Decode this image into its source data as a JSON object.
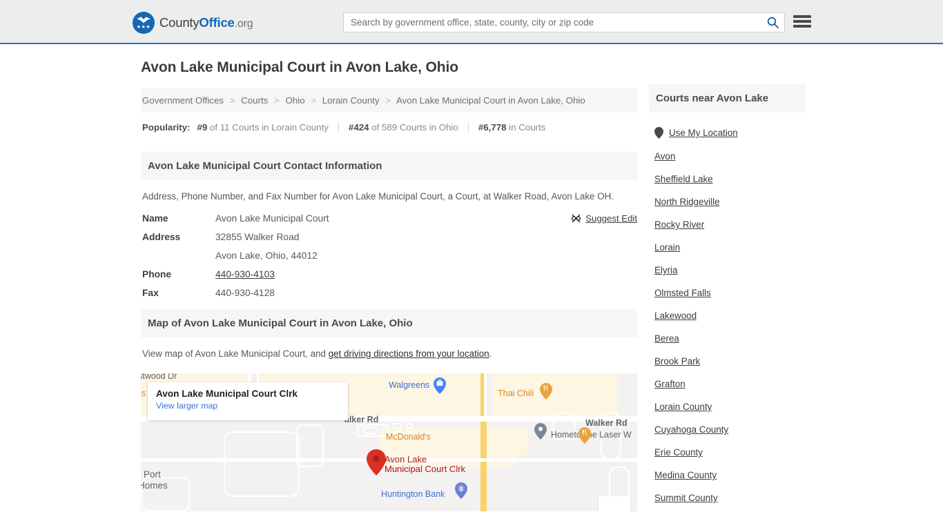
{
  "header": {
    "logo_text_county": "County",
    "logo_text_office": "Office",
    "logo_text_org": ".org",
    "logo_icon": "eagle-stars-emblem",
    "search_placeholder": "Search by government office, state, county, city or zip code",
    "search_value": "",
    "search_icon": "search-icon",
    "menu_icon": "hamburger-menu-icon"
  },
  "main": {
    "title": "Avon Lake Municipal Court in Avon Lake, Ohio",
    "breadcrumb": [
      "Government Offices",
      "Courts",
      "Ohio",
      "Lorain County",
      "Avon Lake Municipal Court in Avon Lake, Ohio"
    ],
    "breadcrumb_separator": ">",
    "popularity": {
      "label": "Popularity:",
      "stats": [
        {
          "rank": "#9",
          "rest": " of 11 Courts in Lorain County"
        },
        {
          "rank": "#424",
          "rest": " of 589 Courts in Ohio"
        },
        {
          "rank": "#6,778",
          "rest": " in Courts"
        }
      ]
    },
    "contact_section": {
      "heading": "Avon Lake Municipal Court Contact Information",
      "description": "Address, Phone Number, and Fax Number for Avon Lake Municipal Court, a Court, at Walker Road, Avon Lake OH.",
      "suggest_edit_label": "Suggest Edit",
      "suggest_edit_icon": "edit-icon",
      "rows": [
        {
          "key": "Name",
          "value": "Avon Lake Municipal Court",
          "link": false
        },
        {
          "key": "Address",
          "value": "32855 Walker Road",
          "link": false
        },
        {
          "key": "",
          "value": "Avon Lake, Ohio, 44012",
          "link": false
        },
        {
          "key": "Phone",
          "value": "440-930-4103",
          "link": true
        },
        {
          "key": "Fax",
          "value": "440-930-4128",
          "link": false
        }
      ]
    },
    "map_section": {
      "heading": "Map of Avon Lake Municipal Court in Avon Lake, Ohio",
      "description_before": "View map of Avon Lake Municipal Court, and ",
      "description_link": "get driving directions from your location",
      "description_after": ".",
      "infocard_title": "Avon Lake Municipal Court Clrk",
      "infocard_link": "View larger map",
      "marker_label_line1": "Avon Lake",
      "marker_label_line2": "Municipal Court Clrk",
      "poi_labels": [
        {
          "text": "Walgreens",
          "color": "blue"
        },
        {
          "text": "Thai Chili",
          "color": "orange"
        },
        {
          "text": "McDonald's",
          "color": "orange"
        },
        {
          "text": "Hometowne Laser W",
          "color": "gray"
        },
        {
          "text": "Huntington Bank",
          "color": "blue"
        },
        {
          "text": "Walker Rd",
          "color": "gray"
        },
        {
          "text": "alker Rd",
          "color": "gray"
        },
        {
          "text": "stwood Dr",
          "color": "gray"
        },
        {
          "text": "Port",
          "color": "gray"
        },
        {
          "text": "Homes",
          "color": "gray"
        },
        {
          "text": "gs",
          "color": "orange"
        }
      ]
    }
  },
  "sidebar": {
    "heading": "Courts near Avon Lake",
    "location_icon": "map-pin-icon",
    "items": [
      "Use My Location",
      "Avon",
      "Sheffield Lake",
      "North Ridgeville",
      "Rocky River",
      "Lorain",
      "Elyria",
      "Olmsted Falls",
      "Lakewood",
      "Berea",
      "Brook Park",
      "Grafton",
      "Lorain County",
      "Cuyahoga County",
      "Erie County",
      "Medina County",
      "Summit County"
    ]
  },
  "colors": {
    "brand_blue": "#1468b3",
    "header_bg": "#eceded",
    "header_rule": "#2f6ea8",
    "panel_bg": "#f6f6f6",
    "marker_red": "#d93025",
    "poi_orange": "#e8a33d",
    "poi_blue": "#4285f4",
    "road_yellow": "#f9d26b"
  }
}
